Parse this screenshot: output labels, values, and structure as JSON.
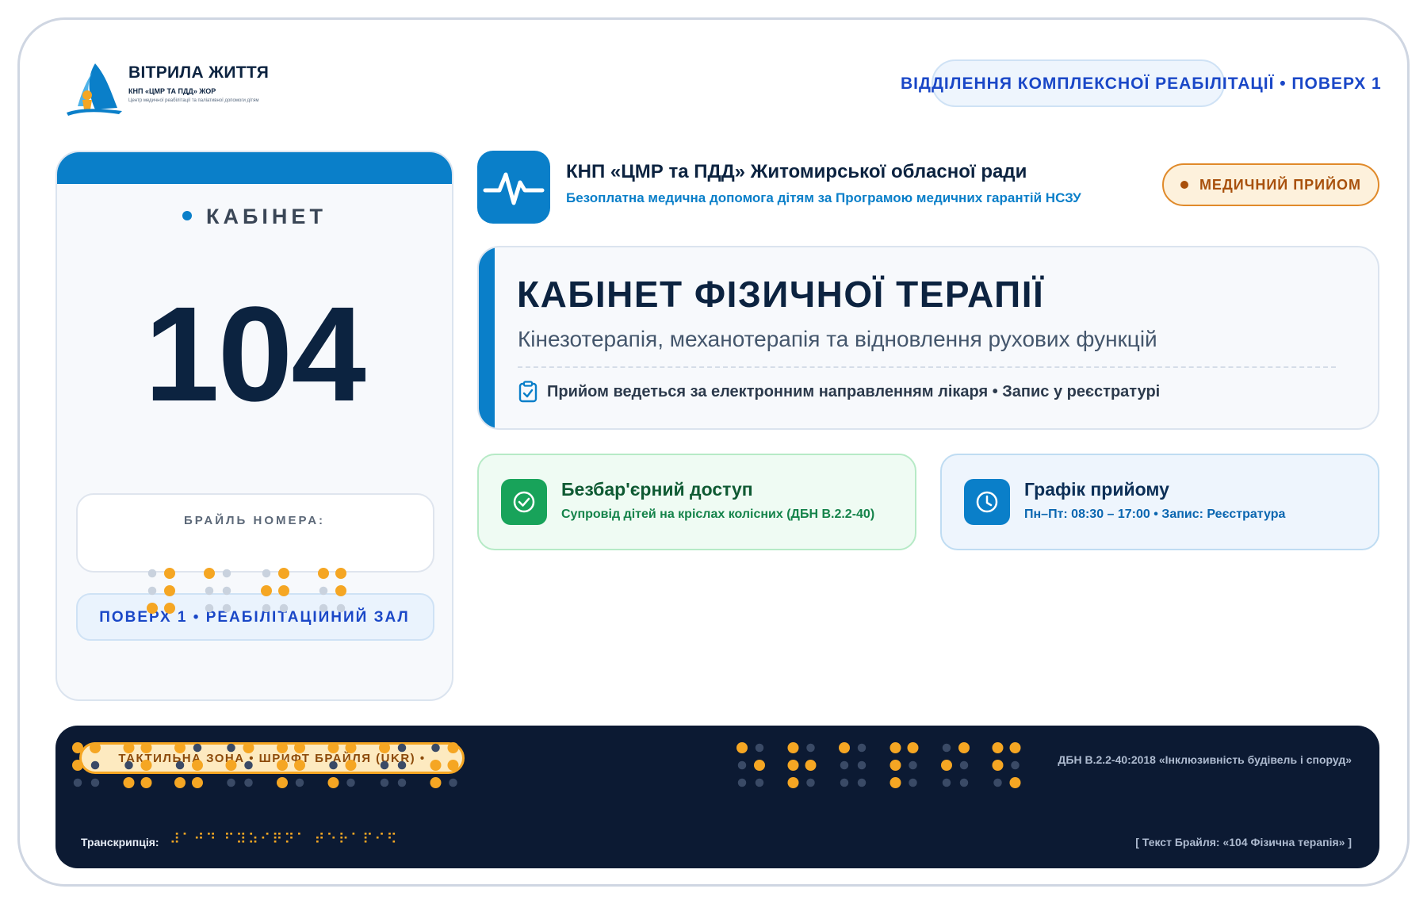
{
  "brand": {
    "name": "ВІТРИЛА ЖИТТЯ",
    "subtitle": "КНП «ЦМР ТА ПДД» ЖОР",
    "tagline": "Центр медичної реабілітації та паліативної допомоги дітям"
  },
  "header": {
    "department": "ВІДДІЛЕННЯ КОМПЛЕКСНОЇ РЕАБІЛІТАЦІЇ • ПОВЕРХ 1"
  },
  "room_card": {
    "label": "КАБІНЕТ",
    "number": "104",
    "braille_label": "БРАЙЛЬ НОМЕРА:",
    "location": "ПОВЕРХ 1 • РЕАБІЛІТАЦІЙНИЙ ЗАЛ"
  },
  "org": {
    "name": "КНП «ЦМР та ПДД» Житомирської обласної ради",
    "program": "Безоплатна медична допомога дітям за Програмою медичних гарантій НСЗУ",
    "badge": "МЕДИЧНИЙ ПРИЙОМ"
  },
  "room_info": {
    "title": "КАБІНЕТ ФІЗИЧНОЇ ТЕРАПІЇ",
    "description": "Кінезотерапія, механотерапія та відновлення рухових функцій",
    "note": "Прийом ведеться за електронним направленням лікаря • Запис у реєстратурі"
  },
  "access": {
    "title": "Безбар'єрний доступ",
    "subtitle": "Супровід дітей на кріслах колісних (ДБН В.2.2-40)"
  },
  "schedule": {
    "title": "Графік прийому",
    "subtitle": "Пн–Пт: 08:30 – 17:00 • Запис: Реєстратура"
  },
  "tactile": {
    "zone_label": "ТАКТИЛЬНА ЗОНА • ШРИФТ БРАЙЛЯ (UKR) •",
    "standard": "ДБН В.2.2-40:2018 «Інклюзивність будівель і споруд»",
    "transcription_label": "Транскрипція:",
    "transcription": "⠼⠁⠚⠙ ⠋⠽⠵⠊⠟⠝⠁ ⠞⠑⠗⠁⠏⠊⠫",
    "braille_text": "[ Текст Брайля: «104 Фізична терапія» ]"
  },
  "colors": {
    "primary": "#0a7fc9",
    "navy": "#0c2340",
    "accent_orange": "#f5a623",
    "dark_panel": "#0c1a33",
    "green": "#18a35a"
  }
}
